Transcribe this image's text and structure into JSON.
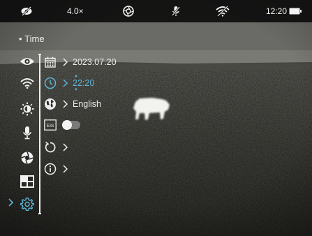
{
  "status_bar": {
    "visibility_icon": "eye-off-icon",
    "zoom": "4.0×",
    "record_icon": "aperture-icon",
    "mic_icon": "mic-off-icon",
    "wifi_icon": "wifi-off-icon",
    "time": "12:20",
    "battery_icon": "battery-icon"
  },
  "menu": {
    "section_title": "Time",
    "sidebar": [
      {
        "icon": "eye-icon",
        "selected": false
      },
      {
        "icon": "wifi-icon",
        "selected": false
      },
      {
        "icon": "brightness-icon",
        "selected": false
      },
      {
        "icon": "microphone-icon",
        "selected": false
      },
      {
        "icon": "aperture-icon",
        "selected": false
      },
      {
        "icon": "grid-icon",
        "selected": false
      },
      {
        "icon": "settings-gear-icon",
        "selected": true
      }
    ],
    "rows": [
      {
        "icon": "calendar-icon",
        "label": "2023.07.20",
        "has_arrow": true
      },
      {
        "icon": "clock-icon",
        "label": "22:20",
        "has_arrow": true,
        "active": true
      },
      {
        "icon": "globe-icon",
        "label": "English",
        "has_arrow": true
      },
      {
        "icon": "eis-icon",
        "icon_text": "EIS",
        "toggle_on": false
      },
      {
        "icon": "reset-icon",
        "label": "",
        "has_arrow": true
      },
      {
        "icon": "info-icon",
        "label": "",
        "has_arrow": true
      }
    ],
    "colors": {
      "text": "#ededed",
      "accent": "#5bb5d6",
      "bar": "#0a0a0a"
    }
  }
}
